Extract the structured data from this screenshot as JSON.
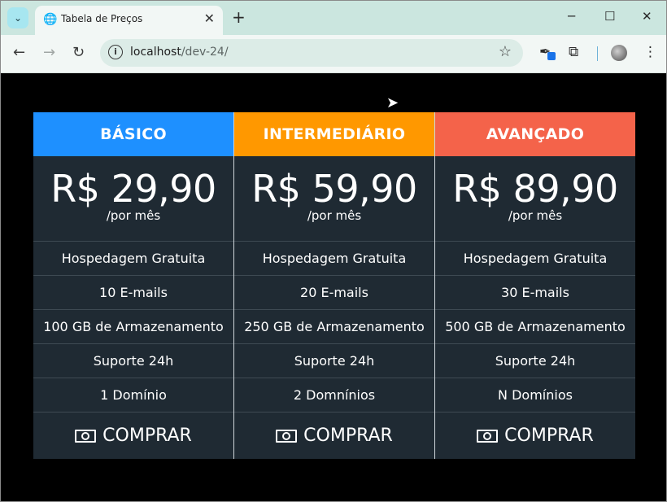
{
  "browser": {
    "tab_title": "Tabela de Preços",
    "url_host": "localhost",
    "url_path": "/dev-24/"
  },
  "colors": {
    "basico": "#1e90ff",
    "intermediario": "#ff9800",
    "avancado": "#f4634a",
    "card_bg": "#1f2a33"
  },
  "icons": [
    "chevron-down-icon",
    "globe-icon",
    "close-icon",
    "plus-icon",
    "minimize-icon",
    "maximize-icon",
    "close-window-icon",
    "back-icon",
    "forward-icon",
    "reload-icon",
    "info-icon",
    "star-icon",
    "extension-icon",
    "puzzle-icon",
    "avatar",
    "more-icon",
    "money-icon"
  ],
  "plans": [
    {
      "name": "BÁSICO",
      "price": "R$ 29,90",
      "period": "/por mês",
      "features": [
        "Hospedagem Gratuita",
        "10 E-mails",
        "100 GB de Armazenamento",
        "Suporte 24h",
        "1 Domínio"
      ],
      "buy_label": "COMPRAR"
    },
    {
      "name": "INTERMEDIÁRIO",
      "price": "R$ 59,90",
      "period": "/por mês",
      "features": [
        "Hospedagem Gratuita",
        "20 E-mails",
        "250 GB de Armazenamento",
        "Suporte 24h",
        "2 Domnínios"
      ],
      "buy_label": "COMPRAR"
    },
    {
      "name": "AVANÇADO",
      "price": "R$ 89,90",
      "period": "/por mês",
      "features": [
        "Hospedagem Gratuita",
        "30 E-mails",
        "500 GB de Armazenamento",
        "Suporte 24h",
        "N Domínios"
      ],
      "buy_label": "COMPRAR"
    }
  ]
}
